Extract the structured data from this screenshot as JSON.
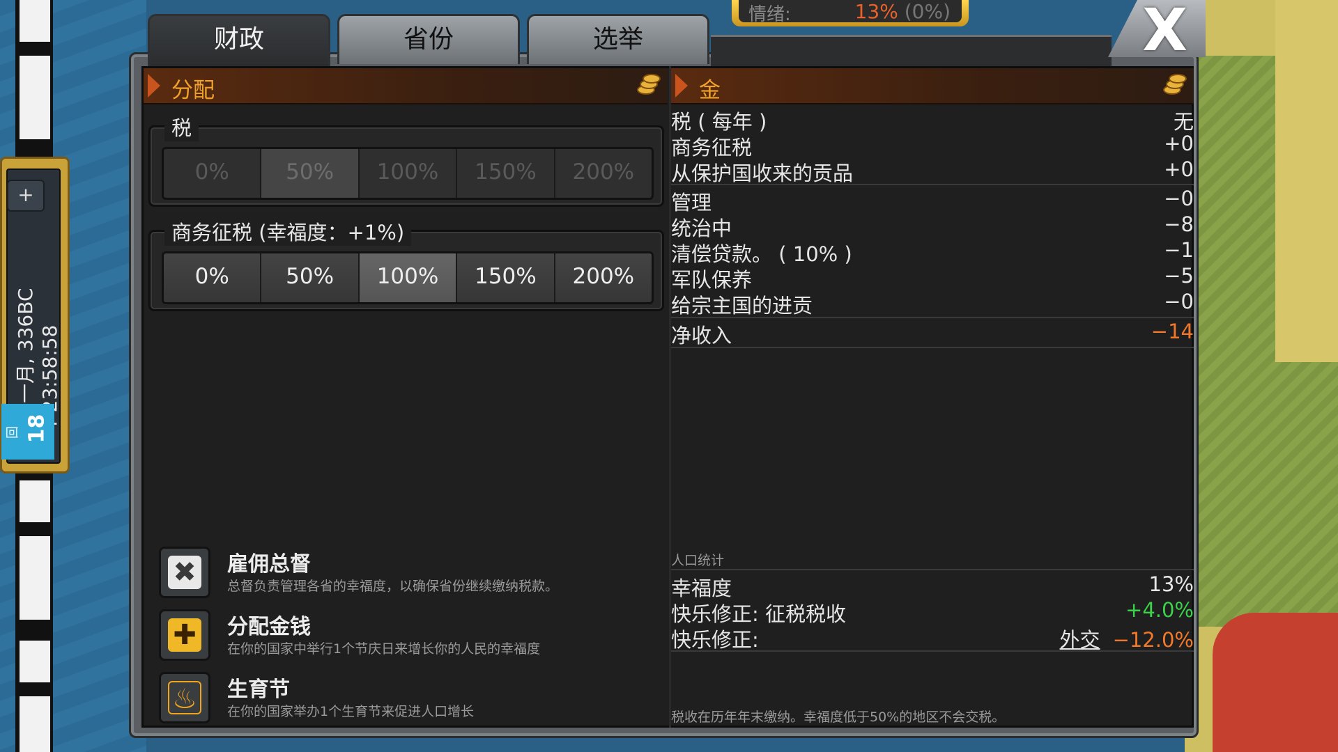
{
  "tabs": [
    "财政",
    "省份",
    "选举"
  ],
  "close_label": "X",
  "mood": {
    "label": "情绪:",
    "value_pct": "13%",
    "value_delta": "(0%)"
  },
  "timer": {
    "plus": "+",
    "date": "十一月, 336BC",
    "time": "T-23:58:58",
    "badge": "回",
    "count": "18"
  },
  "allocation": {
    "title": "分配",
    "tax": {
      "label": "税",
      "options": [
        "0%",
        "50%",
        "100%",
        "150%",
        "200%"
      ],
      "selected": "50%",
      "disabled": true
    },
    "commerce": {
      "label": "商务征税 (幸福度：+1%)",
      "options": [
        "0%",
        "50%",
        "100%",
        "150%",
        "200%"
      ],
      "selected": "100%"
    }
  },
  "actions": [
    {
      "icon": "cancel-x-icon",
      "title": "雇佣总督",
      "desc": "总督负责管理各省的幸福度，以确保省份继续缴纳税款。"
    },
    {
      "icon": "plus-icon",
      "title": "分配金钱",
      "desc": "在你的国家中举行1个节庆日来增长你的人民的幸福度"
    },
    {
      "icon": "fire-icon",
      "title": "生育节",
      "desc": "在你的国家举办1个生育节来促进人口增长"
    }
  ],
  "gold": {
    "title": "金",
    "income": [
      {
        "label": "税 ( 每年 )",
        "value": "无"
      },
      {
        "label": "商务征税",
        "value": "+0"
      },
      {
        "label": "从保护国收来的贡品",
        "value": "+0"
      }
    ],
    "expenses": [
      {
        "label": "管理",
        "value": "−0"
      },
      {
        "label": "统治中",
        "value": "−8"
      },
      {
        "label": "清偿贷款。 ( 10% )",
        "value": "−1"
      },
      {
        "label": "军队保养",
        "value": "−5"
      },
      {
        "label": "给宗主国的进贡",
        "value": "−0"
      }
    ],
    "net": {
      "label": "净收入",
      "value": "−14"
    }
  },
  "stats": {
    "title": "人口统计",
    "happiness": {
      "label": "幸福度",
      "value": "13%"
    },
    "mod_tax": {
      "label": "快乐修正: 征税税收",
      "value": "+4.0%"
    },
    "mod_other": {
      "label": "快乐修正:",
      "link": "外交",
      "value": "−12.0%"
    }
  },
  "footer": "税收在历年年末缴纳。幸福度低于50%的地区不会交税。",
  "colors": {
    "accent_orange": "#f0a22a",
    "negative": "#f2782a",
    "positive": "#3bd24a"
  }
}
